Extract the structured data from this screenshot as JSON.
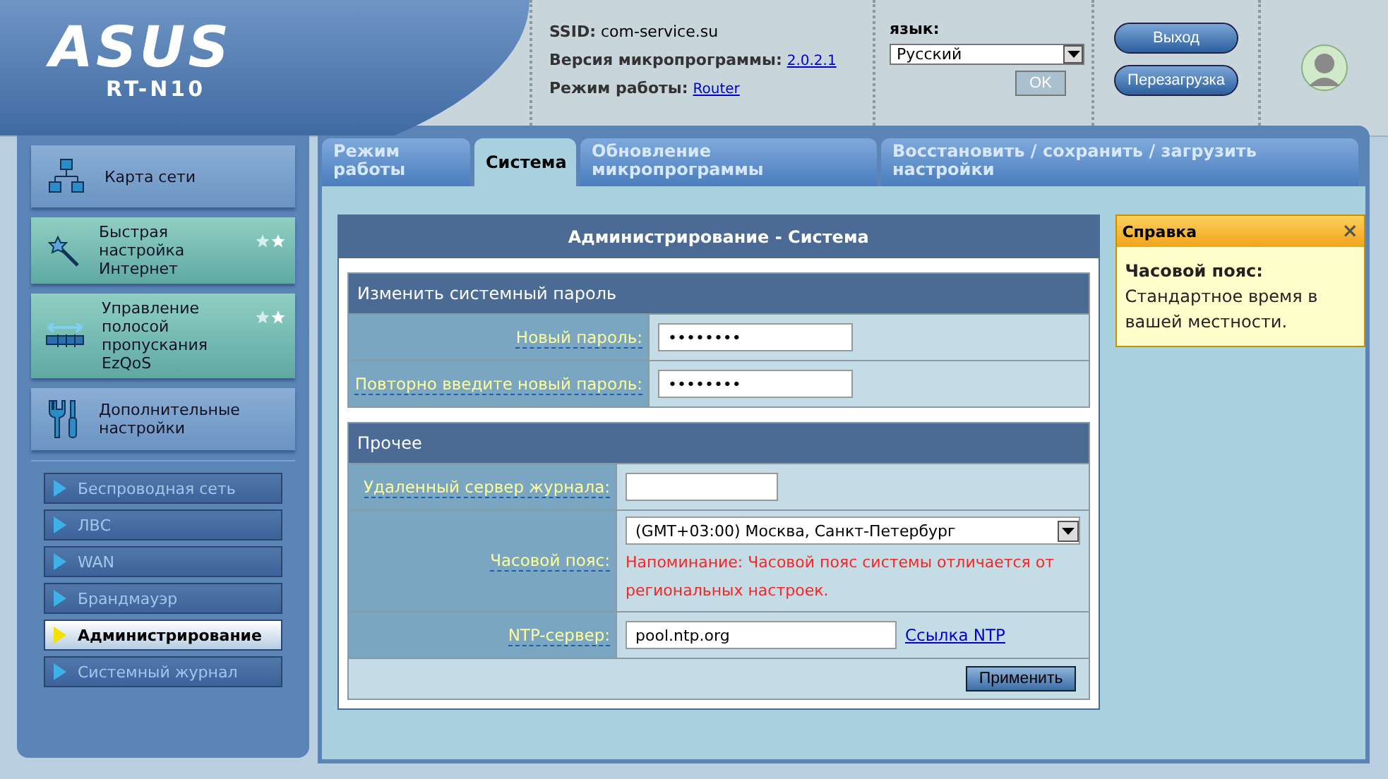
{
  "header": {
    "brand": "ASUS",
    "model": "RT-N10",
    "info": [
      {
        "label": "SSID:",
        "value": "com-service.su",
        "kind": "text"
      },
      {
        "label": "Версия микропрограммы:",
        "value": "2.0.2.1",
        "kind": "link"
      },
      {
        "label": "Режим работы:",
        "value": "Router",
        "kind": "link"
      }
    ],
    "language": {
      "label": "язык:",
      "value": "Русский",
      "ok": "OK",
      "ok_disabled": true
    },
    "buttons": [
      "Выход",
      "Перезагрузка"
    ]
  },
  "sidebar": {
    "items": [
      {
        "label": "Карта сети",
        "kind": "network",
        "highlighted": false
      },
      {
        "label": "Быстрая настройка Интернет",
        "kind": "wand",
        "highlighted": true
      },
      {
        "label": "Управление полосой пропускания EzQoS",
        "kind": "bandwidth",
        "highlighted": true
      },
      {
        "label": "Дополнительные настройки",
        "kind": "tools",
        "highlighted": false
      }
    ],
    "submenu": [
      {
        "label": "Беспроводная сеть",
        "selected": false
      },
      {
        "label": "ЛВС",
        "selected": false
      },
      {
        "label": "WAN",
        "selected": false
      },
      {
        "label": "Брандмауэр",
        "selected": false
      },
      {
        "label": "Администрирование",
        "selected": true
      },
      {
        "label": "Системный журнал",
        "selected": false
      }
    ]
  },
  "tabs": [
    {
      "label": "Режим работы",
      "selected": false
    },
    {
      "label": "Система",
      "selected": true
    },
    {
      "label": "Обновление микропрограммы",
      "selected": false
    },
    {
      "label": "Восстановить / сохранить / загрузить настройки",
      "selected": false
    }
  ],
  "form": {
    "title": "Администрирование - Система",
    "sections": [
      {
        "title": "Изменить системный пароль",
        "rows": [
          {
            "label": "Новый пароль:",
            "kind": "input",
            "value": "••••••••"
          },
          {
            "label": "Повторно введите новый пароль:",
            "kind": "input",
            "value": "••••••••"
          }
        ]
      },
      {
        "title": "Прочее",
        "rows": [
          {
            "label": "Удаленный сервер журнала:",
            "kind": "input"
          },
          {
            "label": "Часовой пояс:",
            "kind": "select",
            "value": "(GMT+03:00) Москва, Санкт-Петербург",
            "warning": "Напоминание: Часовой пояс системы отличается от региональных настроек."
          },
          {
            "label": "NTP-сервер:",
            "kind": "input_link",
            "value": "pool.ntp.org",
            "link": "Ссылка NTP"
          }
        ]
      }
    ],
    "apply": "Применить"
  },
  "help": {
    "title": "Справка",
    "close": "×",
    "heading": "Часовой пояс:",
    "text": "Стандартное время в вашей местности."
  }
}
